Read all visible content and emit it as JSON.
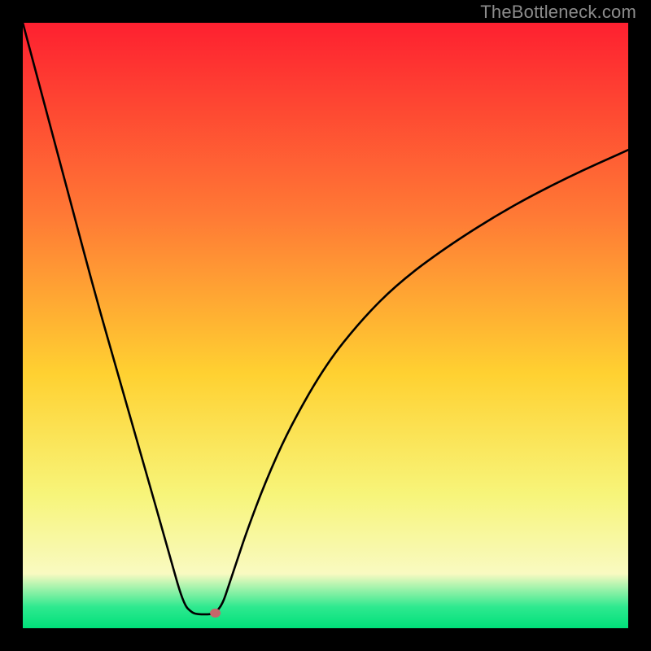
{
  "watermark": "TheBottleneck.com",
  "chart_data": {
    "type": "line",
    "title": "",
    "xlabel": "",
    "ylabel": "",
    "xlim": [
      0,
      100
    ],
    "ylim": [
      0,
      100
    ],
    "grid": false,
    "curve": {
      "name": "bottleneck-curve",
      "color": "#000000",
      "x": [
        0,
        4,
        8,
        12,
        16,
        20,
        24,
        26.5,
        28,
        29,
        30,
        31,
        31.8,
        33,
        34,
        35.5,
        37,
        40,
        44,
        50,
        56,
        62,
        70,
        80,
        90,
        100
      ],
      "y": [
        100,
        85,
        70,
        55,
        41,
        27,
        13,
        4,
        2.5,
        2.3,
        2.3,
        2.3,
        2.5,
        4,
        7,
        11.5,
        16,
        24,
        33,
        43.5,
        51,
        57,
        63,
        69.3,
        74.5,
        79
      ]
    },
    "highlight_point": {
      "x": 31.8,
      "y": 2.5,
      "color": "#c5676a"
    },
    "background_gradient": {
      "top": "#fe2030",
      "upper_mid": "#ff7a35",
      "mid": "#ffd131",
      "lower_mid": "#f7f57a",
      "pale": "#f9fac1",
      "green": "#2ee98f",
      "bottom": "#00e07a"
    }
  }
}
